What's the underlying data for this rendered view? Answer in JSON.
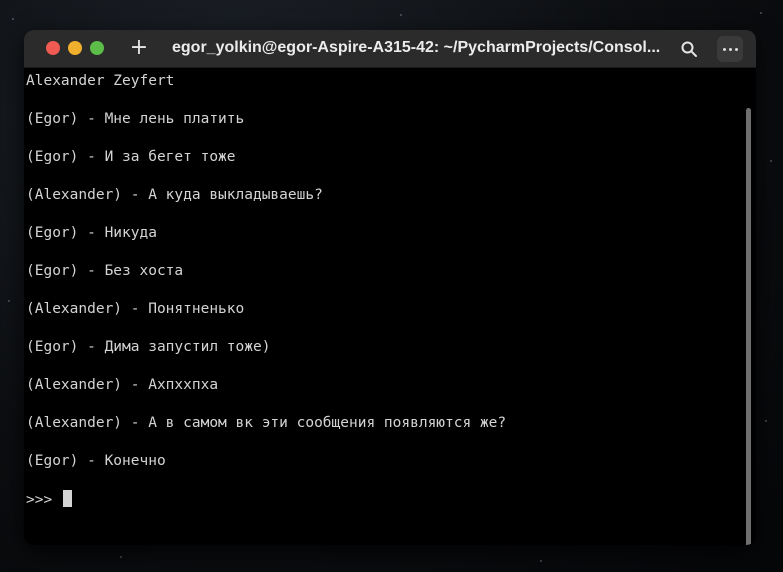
{
  "window": {
    "title": "egor_yolkin@egor-Aspire-A315-42: ~/PycharmProjects/Consol...",
    "new_tab_glyph": "+",
    "controls": {
      "close_color": "#ef5b52",
      "minimize_color": "#f0b02e",
      "maximize_color": "#5dbd49"
    }
  },
  "terminal": {
    "lines": [
      "Alexander Zeyfert",
      "(Egor) - Мне лень платить",
      "(Egor) - И за бегет тоже",
      "(Alexander) - А куда выкладываешь?",
      "(Egor) - Никуда",
      "(Egor) - Без хоста",
      "(Alexander) - Понятненько",
      "(Egor) - Дима запустил тоже)",
      "(Alexander) - Ахпххпха",
      "(Alexander) - А в самом вк эти сообщения появляются же?",
      "(Egor) - Конечно"
    ],
    "prompt": ">>> "
  }
}
